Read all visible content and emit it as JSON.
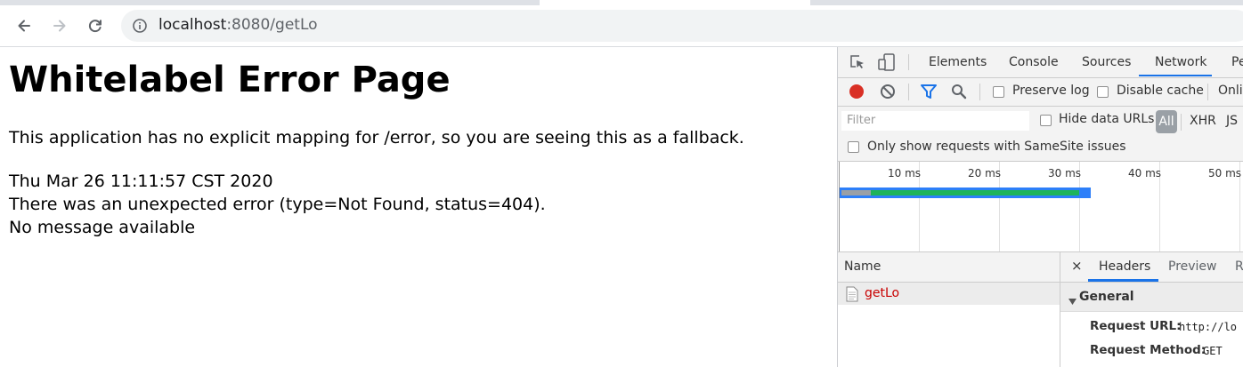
{
  "browser": {
    "url_host": "localhost",
    "url_rest": ":8080/getLo"
  },
  "page": {
    "title": "Whitelabel Error Page",
    "message": "This application has no explicit mapping for /error, so you are seeing this as a fallback.",
    "timestamp": "Thu Mar 26 11:11:57 CST 2020",
    "error_line": "There was an unexpected error (type=Not Found, status=404).",
    "detail": "No message available"
  },
  "devtools": {
    "tabs": [
      "Elements",
      "Console",
      "Sources",
      "Network",
      "Pe"
    ],
    "active_tab": "Network",
    "toolbar": {
      "preserve_log": "Preserve log",
      "disable_cache": "Disable cache",
      "online": "Onli"
    },
    "filter": {
      "placeholder": "Filter",
      "hide_data_urls": "Hide data URLs",
      "all": "All",
      "xhr": "XHR",
      "js": "JS",
      "samesite": "Only show requests with SameSite issues"
    },
    "timeline": {
      "ticks": [
        "10 ms",
        "20 ms",
        "30 ms",
        "40 ms",
        "50 ms"
      ]
    },
    "requests": {
      "column": "Name",
      "items": [
        {
          "name": "getLo",
          "status_color": "#c80000"
        }
      ]
    },
    "details": {
      "close": "×",
      "tabs": [
        "Headers",
        "Preview",
        "R"
      ],
      "active_tab": "Headers",
      "section": "General",
      "request_url_key": "Request URL:",
      "request_url_val": "http://lo",
      "request_method_key": "Request Method:",
      "request_method_val": "GET"
    }
  },
  "colors": {
    "accent": "#1a73e8",
    "record": "#d93025",
    "filter_icon": "#1a73e8",
    "bar_blue": "#2d7ff9",
    "bar_green": "#1eb35a"
  }
}
